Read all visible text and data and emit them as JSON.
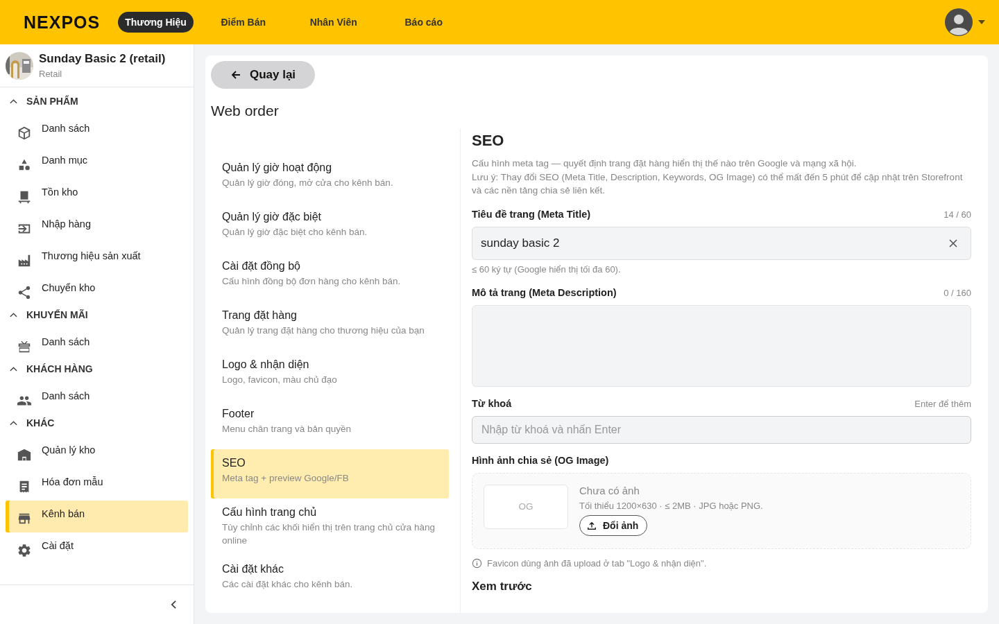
{
  "header": {
    "logo": "NEXPOS",
    "nav": [
      {
        "label": "Thương Hiệu",
        "selected": true
      },
      {
        "label": "Điểm Bán",
        "selected": false
      },
      {
        "label": "Nhân Viên",
        "selected": false
      },
      {
        "label": "Báo cáo",
        "selected": false
      }
    ]
  },
  "store": {
    "name": "Sunday Basic 2 (retail)",
    "type": "Retail"
  },
  "sidebar": {
    "groups": [
      {
        "title": "SẢN PHẨM",
        "expanded": true,
        "items": [
          {
            "label": "Danh sách",
            "selected": false
          },
          {
            "label": "Danh mục",
            "selected": false
          },
          {
            "label": "Tồn kho",
            "selected": false
          },
          {
            "label": "Nhập hàng",
            "selected": false
          },
          {
            "label": "Thương hiệu sản xuất",
            "selected": false
          },
          {
            "label": "Chuyển kho",
            "selected": false
          }
        ]
      },
      {
        "title": "KHUYẾN MÃI",
        "expanded": true,
        "items": [
          {
            "label": "Danh sách",
            "selected": false
          }
        ]
      },
      {
        "title": "KHÁCH HÀNG",
        "expanded": true,
        "items": [
          {
            "label": "Danh sách",
            "selected": false
          }
        ]
      },
      {
        "title": "KHÁC",
        "expanded": true,
        "items": [
          {
            "label": "Quản lý kho",
            "selected": false
          },
          {
            "label": "Hóa đơn mẫu",
            "selected": false
          },
          {
            "label": "Kênh bán",
            "selected": true
          },
          {
            "label": "Cài đặt",
            "selected": false
          }
        ]
      }
    ]
  },
  "back_button": "Quay lại",
  "page_title": "Web order",
  "settings_list": [
    {
      "title": "Quản lý giờ hoạt động",
      "description": "Quản lý giờ đóng, mở cửa cho kênh bán.",
      "selected": false
    },
    {
      "title": "Quản lý giờ đặc biệt",
      "description": "Quản lý giờ đặc biệt cho kênh bán.",
      "selected": false
    },
    {
      "title": "Cài đặt đồng bộ",
      "description": "Cấu hình đồng bộ đơn hàng cho kênh bán.",
      "selected": false
    },
    {
      "title": "Trang đặt hàng",
      "description": "Quản lý trang đặt hàng cho thương hiệu của bạn",
      "selected": false
    },
    {
      "title": "Logo & nhận diện",
      "description": "Logo, favicon, màu chủ đạo",
      "selected": false
    },
    {
      "title": "Footer",
      "description": "Menu chân trang và bản quyền",
      "selected": false
    },
    {
      "title": "SEO",
      "description": "Meta tag + preview Google/FB",
      "selected": true
    },
    {
      "title": "Cấu hình trang chủ",
      "description": "Tùy chỉnh các khối hiển thị trên trang chủ cửa hàng online",
      "selected": false
    },
    {
      "title": "Cài đặt khác",
      "description": "Các cài đặt khác cho kênh bán.",
      "selected": false
    }
  ],
  "seo": {
    "title": "SEO",
    "description": "Cấu hình meta tag — quyết định trang đặt hàng hiển thị thế nào trên Google và mạng xã hội.",
    "note": "Lưu ý: Thay đổi SEO (Meta Title, Description, Keywords, OG Image) có thể mất đến 5 phút để cập nhật trên Storefront và các nền tảng chia sẻ liên kết.",
    "meta_title": {
      "label": "Tiêu đề trang (Meta Title)",
      "counter": "14 / 60",
      "value": "sunday basic 2",
      "hint": "≤ 60 ký tự (Google hiển thị tối đa 60)."
    },
    "meta_description": {
      "label": "Mô tả trang (Meta Description)",
      "counter": "0 / 160"
    },
    "keywords": {
      "label": "Từ khoá",
      "hint": "Enter để thêm",
      "placeholder": "Nhập từ khoá và nhấn Enter"
    },
    "og_image": {
      "label": "Hình ảnh chia sẻ (OG Image)",
      "thumb": "OG",
      "status": "Chưa có ảnh",
      "requirements": "Tối thiểu 1200×630 · ≤ 2MB · JPG hoặc PNG.",
      "button": "Đổi ảnh"
    },
    "favicon_note": "Favicon dùng ảnh đã upload ở tab \"Logo & nhận diện\".",
    "preview_title": "Xem trước"
  }
}
